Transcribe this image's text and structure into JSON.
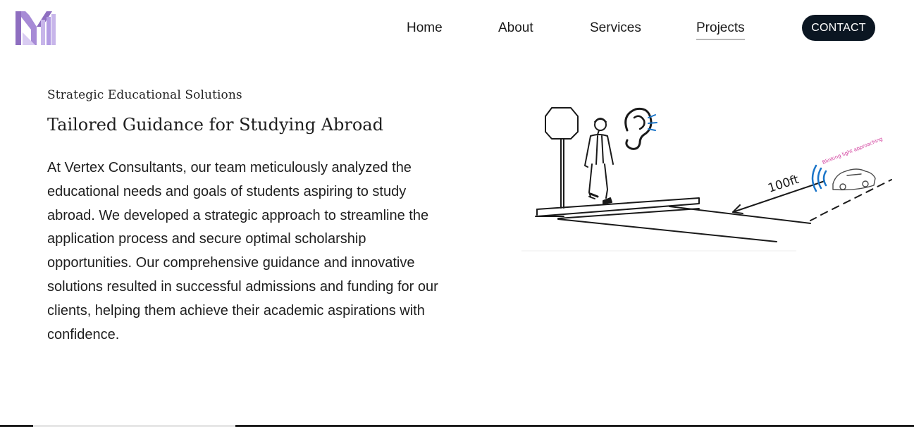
{
  "nav": {
    "items": [
      {
        "label": "Home"
      },
      {
        "label": "About"
      },
      {
        "label": "Services"
      },
      {
        "label": "Projects",
        "active": true
      }
    ],
    "contact_label": "CONTACT"
  },
  "content": {
    "eyebrow": "Strategic Educational Solutions",
    "heading": "Tailored Guidance for Studying Abroad",
    "body": "At Vertex Consultants, our team meticulously analyzed the educational needs and goals of students aspiring to study abroad. We developed a strategic approach to streamline the application process and secure optimal scholarship opportunities. Our comprehensive guidance and innovative solutions resulted in successful admissions and funding for our clients, helping them achieve their academic aspirations with confidence."
  },
  "illustration": {
    "distance_label": "100ft",
    "car_note": "Blinking light approaching"
  },
  "colors": {
    "logo_primary": "#8e6ec0",
    "logo_light": "#c7b5ea",
    "contact_bg": "#0b1622",
    "sound_wave": "#1a75c9",
    "car_note": "#d0389a"
  },
  "icons": {
    "logo": "brand-logo-icon",
    "ear": "ear-icon"
  }
}
